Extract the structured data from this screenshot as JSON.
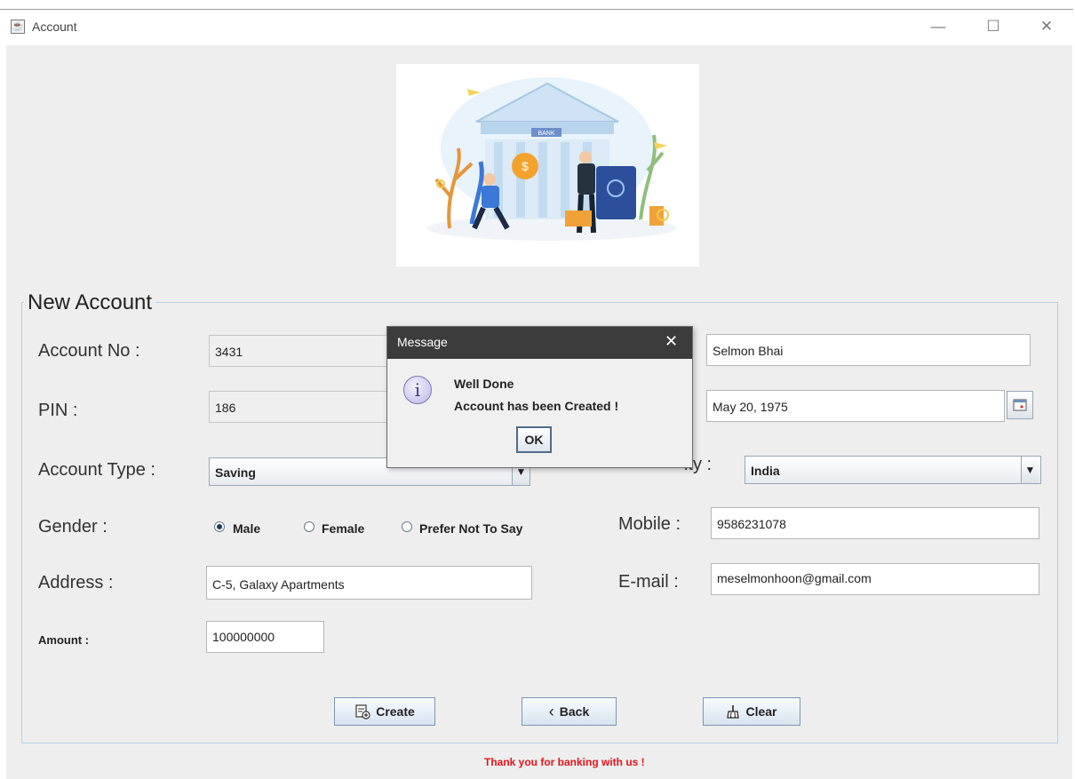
{
  "window": {
    "title": "Account",
    "app_icon": "java-icon",
    "controls": {
      "minimize": "—",
      "maximize": "☐",
      "close": "✕"
    }
  },
  "illustration": {
    "sign": "BANK"
  },
  "form": {
    "group_title": "New Account",
    "account_no": {
      "label": "Account No :",
      "value": "3431"
    },
    "pin": {
      "label": "PIN :",
      "value": "186"
    },
    "account_type": {
      "label": "Account Type :",
      "value": "Saving"
    },
    "gender": {
      "label": "Gender :",
      "options": [
        "Male",
        "Female",
        "Prefer Not To Say"
      ],
      "selected": "Male"
    },
    "address": {
      "label": "Address :",
      "value": "C-5, Galaxy Apartments"
    },
    "amount": {
      "label": "Amount :",
      "value": "100000000"
    },
    "name": {
      "value": "Selmon Bhai"
    },
    "dob": {
      "value": "May 20, 1975"
    },
    "nationality": {
      "label_visible": "ity :",
      "value": "India"
    },
    "mobile": {
      "label": "Mobile :",
      "value": "9586231078"
    },
    "email": {
      "label": "E-mail :",
      "value": "meselmonhoon@gmail.com"
    }
  },
  "buttons": {
    "create": "Create",
    "back": "Back",
    "clear": "Clear"
  },
  "footer": {
    "text": "Thank you for banking with us !",
    "color": "#e3141b"
  },
  "dialog": {
    "title": "Message",
    "close": "✕",
    "icon": "info-icon",
    "line1": "Well Done",
    "line2": "Account has been Created !",
    "ok": "OK"
  }
}
